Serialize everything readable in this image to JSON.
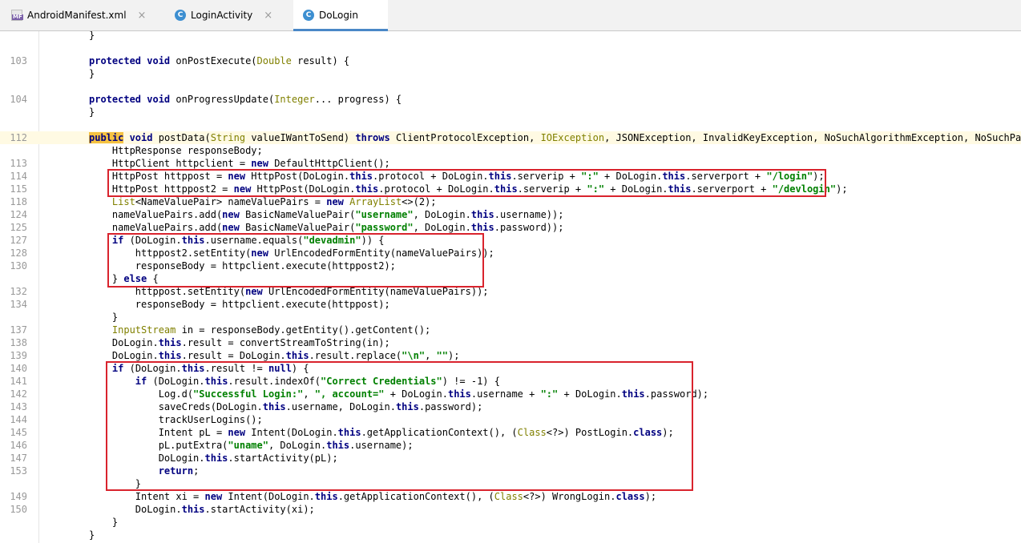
{
  "tabs": [
    {
      "label": "AndroidManifest.xml",
      "icon": "manifest-file-icon",
      "active": false
    },
    {
      "label": "LoginActivity",
      "icon": "java-class-icon",
      "active": false
    },
    {
      "label": "DoLogin",
      "icon": "java-class-icon",
      "active": true
    }
  ],
  "close_glyph": "×",
  "highlight_color": "#d9232d",
  "lines": [
    {
      "n": "",
      "c": [
        {
          "t": "}"
        }
      ]
    },
    {
      "n": "",
      "c": []
    },
    {
      "n": "103",
      "c": [
        {
          "t": "protected void ",
          "k": "kw"
        },
        {
          "t": "onPostExecute("
        },
        {
          "t": "Double ",
          "k": "ty"
        },
        {
          "t": "result) {"
        }
      ]
    },
    {
      "n": "",
      "c": [
        {
          "t": "}"
        }
      ]
    },
    {
      "n": "",
      "c": []
    },
    {
      "n": "104",
      "c": [
        {
          "t": "protected void ",
          "k": "kw"
        },
        {
          "t": "onProgressUpdate("
        },
        {
          "t": "Integer",
          "k": "ty"
        },
        {
          "t": "... progress) {"
        }
      ]
    },
    {
      "n": "",
      "c": [
        {
          "t": "}"
        }
      ]
    },
    {
      "n": "",
      "c": []
    },
    {
      "n": "112",
      "hl": true,
      "c": [
        {
          "t": "public",
          "k": "kwhl"
        },
        {
          "t": " void ",
          "k": "kw"
        },
        {
          "t": "postData("
        },
        {
          "t": "String ",
          "k": "ty"
        },
        {
          "t": "valueIWantToSend) "
        },
        {
          "t": "throws ",
          "k": "kw"
        },
        {
          "t": "ClientProtocolException, "
        },
        {
          "t": "IOException",
          "k": "ty"
        },
        {
          "t": ", JSONException, InvalidKeyException, NoSuchAlgorithmException, NoSuchPadding"
        }
      ]
    },
    {
      "n": "",
      "c": [
        {
          "t": "    HttpResponse responseBody;"
        }
      ]
    },
    {
      "n": "113",
      "c": [
        {
          "t": "    HttpClient httpclient = "
        },
        {
          "t": "new ",
          "k": "kw"
        },
        {
          "t": "DefaultHttpClient();"
        }
      ]
    },
    {
      "n": "114",
      "c": [
        {
          "t": "    HttpPost httppost = "
        },
        {
          "t": "new ",
          "k": "kw"
        },
        {
          "t": "HttpPost(DoLogin."
        },
        {
          "t": "this",
          "k": "kw"
        },
        {
          "t": ".protocol + DoLogin."
        },
        {
          "t": "this",
          "k": "kw"
        },
        {
          "t": ".serverip + "
        },
        {
          "t": "\":\"",
          "k": "str"
        },
        {
          "t": " + DoLogin."
        },
        {
          "t": "this",
          "k": "kw"
        },
        {
          "t": ".serverport + "
        },
        {
          "t": "\"/login\"",
          "k": "str"
        },
        {
          "t": ");"
        }
      ]
    },
    {
      "n": "115",
      "c": [
        {
          "t": "    HttpPost httppost2 = "
        },
        {
          "t": "new ",
          "k": "kw"
        },
        {
          "t": "HttpPost(DoLogin."
        },
        {
          "t": "this",
          "k": "kw"
        },
        {
          "t": ".protocol + DoLogin."
        },
        {
          "t": "this",
          "k": "kw"
        },
        {
          "t": ".serverip + "
        },
        {
          "t": "\":\"",
          "k": "str"
        },
        {
          "t": " + DoLogin."
        },
        {
          "t": "this",
          "k": "kw"
        },
        {
          "t": ".serverport + "
        },
        {
          "t": "\"/devlogin\"",
          "k": "str"
        },
        {
          "t": ");"
        }
      ]
    },
    {
      "n": "118",
      "c": [
        {
          "t": "    "
        },
        {
          "t": "List",
          "k": "ty"
        },
        {
          "t": "<NameValuePair> nameValuePairs = "
        },
        {
          "t": "new ",
          "k": "kw"
        },
        {
          "t": "ArrayList",
          "k": "ty"
        },
        {
          "t": "<>(2);"
        }
      ]
    },
    {
      "n": "124",
      "c": [
        {
          "t": "    nameValuePairs.add("
        },
        {
          "t": "new ",
          "k": "kw"
        },
        {
          "t": "BasicNameValuePair("
        },
        {
          "t": "\"username\"",
          "k": "str"
        },
        {
          "t": ", DoLogin."
        },
        {
          "t": "this",
          "k": "kw"
        },
        {
          "t": ".username));"
        }
      ]
    },
    {
      "n": "125",
      "c": [
        {
          "t": "    nameValuePairs.add("
        },
        {
          "t": "new ",
          "k": "kw"
        },
        {
          "t": "BasicNameValuePair("
        },
        {
          "t": "\"password\"",
          "k": "str"
        },
        {
          "t": ", DoLogin."
        },
        {
          "t": "this",
          "k": "kw"
        },
        {
          "t": ".password));"
        }
      ]
    },
    {
      "n": "127",
      "c": [
        {
          "t": "    "
        },
        {
          "t": "if ",
          "k": "kw"
        },
        {
          "t": "(DoLogin."
        },
        {
          "t": "this",
          "k": "kw"
        },
        {
          "t": ".username.equals("
        },
        {
          "t": "\"devadmin\"",
          "k": "str"
        },
        {
          "t": ")) {"
        }
      ]
    },
    {
      "n": "128",
      "c": [
        {
          "t": "        httppost2.setEntity("
        },
        {
          "t": "new ",
          "k": "kw"
        },
        {
          "t": "UrlEncodedFormEntity(nameValuePairs));"
        }
      ]
    },
    {
      "n": "130",
      "c": [
        {
          "t": "        responseBody = httpclient.execute(httppost2);"
        }
      ]
    },
    {
      "n": "",
      "c": [
        {
          "t": "    } "
        },
        {
          "t": "else ",
          "k": "kw"
        },
        {
          "t": "{"
        }
      ]
    },
    {
      "n": "132",
      "c": [
        {
          "t": "        httppost.setEntity("
        },
        {
          "t": "new ",
          "k": "kw"
        },
        {
          "t": "UrlEncodedFormEntity(nameValuePairs));"
        }
      ]
    },
    {
      "n": "134",
      "c": [
        {
          "t": "        responseBody = httpclient.execute(httppost);"
        }
      ]
    },
    {
      "n": "",
      "c": [
        {
          "t": "    }"
        }
      ]
    },
    {
      "n": "137",
      "c": [
        {
          "t": "    "
        },
        {
          "t": "InputStream ",
          "k": "ty"
        },
        {
          "t": "in = responseBody.getEntity().getContent();"
        }
      ]
    },
    {
      "n": "138",
      "c": [
        {
          "t": "    DoLogin."
        },
        {
          "t": "this",
          "k": "kw"
        },
        {
          "t": ".result = convertStreamToString(in);"
        }
      ]
    },
    {
      "n": "139",
      "c": [
        {
          "t": "    DoLogin."
        },
        {
          "t": "this",
          "k": "kw"
        },
        {
          "t": ".result = DoLogin."
        },
        {
          "t": "this",
          "k": "kw"
        },
        {
          "t": ".result.replace("
        },
        {
          "t": "\"\\n\"",
          "k": "str"
        },
        {
          "t": ", "
        },
        {
          "t": "\"\"",
          "k": "str"
        },
        {
          "t": ");"
        }
      ]
    },
    {
      "n": "140",
      "c": [
        {
          "t": "    "
        },
        {
          "t": "if ",
          "k": "kw"
        },
        {
          "t": "(DoLogin."
        },
        {
          "t": "this",
          "k": "kw"
        },
        {
          "t": ".result != "
        },
        {
          "t": "null",
          "k": "kw"
        },
        {
          "t": ") {"
        }
      ]
    },
    {
      "n": "141",
      "c": [
        {
          "t": "        "
        },
        {
          "t": "if ",
          "k": "kw"
        },
        {
          "t": "(DoLogin."
        },
        {
          "t": "this",
          "k": "kw"
        },
        {
          "t": ".result.indexOf("
        },
        {
          "t": "\"Correct Credentials\"",
          "k": "str"
        },
        {
          "t": ") != -1) {"
        }
      ]
    },
    {
      "n": "142",
      "c": [
        {
          "t": "            Log.d("
        },
        {
          "t": "\"Successful Login:\"",
          "k": "str"
        },
        {
          "t": ", "
        },
        {
          "t": "\", account=\"",
          "k": "str"
        },
        {
          "t": " + DoLogin."
        },
        {
          "t": "this",
          "k": "kw"
        },
        {
          "t": ".username + "
        },
        {
          "t": "\":\"",
          "k": "str"
        },
        {
          "t": " + DoLogin."
        },
        {
          "t": "this",
          "k": "kw"
        },
        {
          "t": ".password);"
        }
      ]
    },
    {
      "n": "143",
      "c": [
        {
          "t": "            saveCreds(DoLogin."
        },
        {
          "t": "this",
          "k": "kw"
        },
        {
          "t": ".username, DoLogin."
        },
        {
          "t": "this",
          "k": "kw"
        },
        {
          "t": ".password);"
        }
      ]
    },
    {
      "n": "144",
      "c": [
        {
          "t": "            trackUserLogins();"
        }
      ]
    },
    {
      "n": "145",
      "c": [
        {
          "t": "            Intent pL = "
        },
        {
          "t": "new ",
          "k": "kw"
        },
        {
          "t": "Intent(DoLogin."
        },
        {
          "t": "this",
          "k": "kw"
        },
        {
          "t": ".getApplicationContext(), ("
        },
        {
          "t": "Class",
          "k": "ty"
        },
        {
          "t": "<?>) PostLogin."
        },
        {
          "t": "class",
          "k": "kw"
        },
        {
          "t": ");"
        }
      ]
    },
    {
      "n": "146",
      "c": [
        {
          "t": "            pL.putExtra("
        },
        {
          "t": "\"uname\"",
          "k": "str"
        },
        {
          "t": ", DoLogin."
        },
        {
          "t": "this",
          "k": "kw"
        },
        {
          "t": ".username);"
        }
      ]
    },
    {
      "n": "147",
      "c": [
        {
          "t": "            DoLogin."
        },
        {
          "t": "this",
          "k": "kw"
        },
        {
          "t": ".startActivity(pL);"
        }
      ]
    },
    {
      "n": "153",
      "c": [
        {
          "t": "            "
        },
        {
          "t": "return",
          "k": "kw"
        },
        {
          "t": ";"
        }
      ]
    },
    {
      "n": "",
      "c": [
        {
          "t": "        }"
        }
      ]
    },
    {
      "n": "149",
      "c": [
        {
          "t": "        Intent xi = "
        },
        {
          "t": "new ",
          "k": "kw"
        },
        {
          "t": "Intent(DoLogin."
        },
        {
          "t": "this",
          "k": "kw"
        },
        {
          "t": ".getApplicationContext(), ("
        },
        {
          "t": "Class",
          "k": "ty"
        },
        {
          "t": "<?>) WrongLogin."
        },
        {
          "t": "class",
          "k": "kw"
        },
        {
          "t": ");"
        }
      ]
    },
    {
      "n": "150",
      "c": [
        {
          "t": "        DoLogin."
        },
        {
          "t": "this",
          "k": "kw"
        },
        {
          "t": ".startActivity(xi);"
        }
      ]
    },
    {
      "n": "",
      "c": [
        {
          "t": "    }"
        }
      ]
    },
    {
      "n": "",
      "c": [
        {
          "t": "}"
        }
      ]
    }
  ]
}
